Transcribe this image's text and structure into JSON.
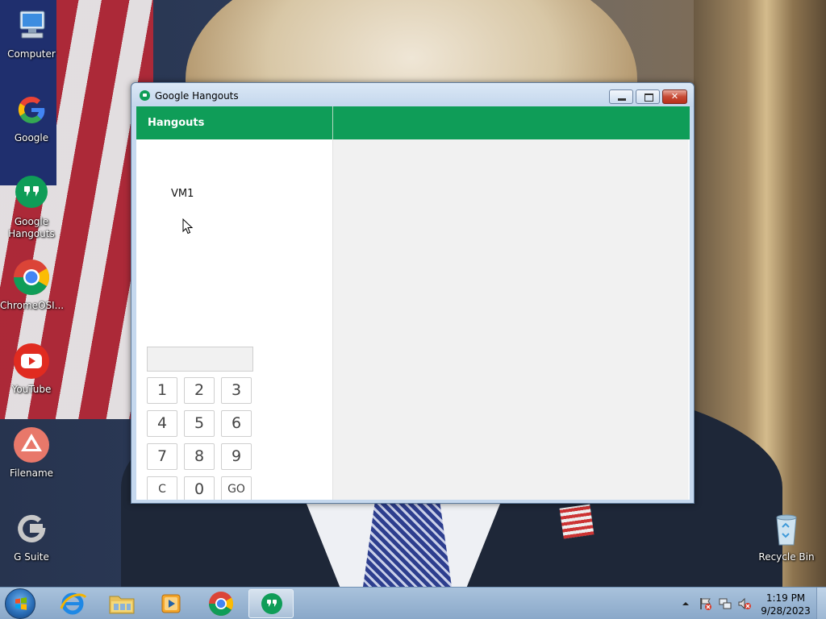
{
  "desktop": {
    "icons": [
      {
        "label": "Computer",
        "icon": "computer-icon"
      },
      {
        "label": "Google",
        "icon": "google-icon"
      },
      {
        "label": "Google Hangouts",
        "line1": "Google",
        "line2": "Hangouts",
        "icon": "hangouts-icon"
      },
      {
        "label": "ChromeOSI...",
        "icon": "chrome-icon"
      },
      {
        "label": "YouTube",
        "icon": "youtube-icon"
      },
      {
        "label": "Filename",
        "icon": "drive-icon"
      },
      {
        "label": "G Suite",
        "icon": "gsuite-icon"
      },
      {
        "label": "Recycle Bin",
        "icon": "recycle-bin-icon"
      }
    ]
  },
  "window": {
    "title": "Google Hangouts",
    "header_label": "Hangouts",
    "contact": "VM1",
    "dialpad": {
      "display_value": "",
      "keys": [
        "1",
        "2",
        "3",
        "4",
        "5",
        "6",
        "7",
        "8",
        "9",
        "C",
        "0",
        "GO"
      ]
    }
  },
  "taskbar": {
    "items": [
      {
        "icon": "internet-explorer-icon"
      },
      {
        "icon": "file-explorer-icon"
      },
      {
        "icon": "media-player-icon"
      },
      {
        "icon": "chrome-icon"
      },
      {
        "icon": "hangouts-icon",
        "active": true
      }
    ],
    "clock": {
      "time": "1:19 PM",
      "date": "9/28/2023"
    }
  },
  "colors": {
    "hangouts_green": "#0f9d58",
    "google_blue": "#4285f4",
    "google_red": "#ea4335",
    "google_yellow": "#fbbc05",
    "youtube_red": "#e02b20"
  }
}
